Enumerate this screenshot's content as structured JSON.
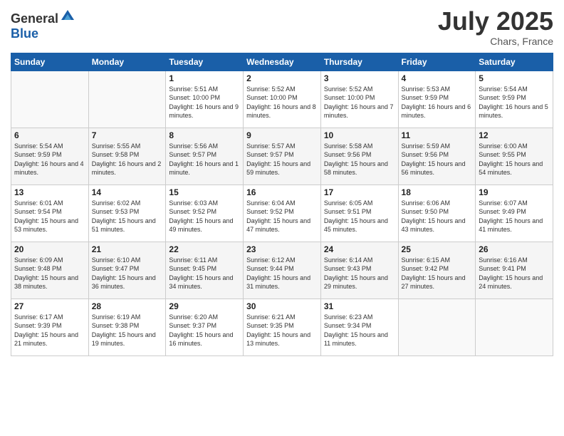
{
  "header": {
    "logo_general": "General",
    "logo_blue": "Blue",
    "month_year": "July 2025",
    "location": "Chars, France"
  },
  "days_of_week": [
    "Sunday",
    "Monday",
    "Tuesday",
    "Wednesday",
    "Thursday",
    "Friday",
    "Saturday"
  ],
  "weeks": [
    [
      {
        "day": "",
        "info": ""
      },
      {
        "day": "",
        "info": ""
      },
      {
        "day": "1",
        "info": "Sunrise: 5:51 AM\nSunset: 10:00 PM\nDaylight: 16 hours and 9 minutes."
      },
      {
        "day": "2",
        "info": "Sunrise: 5:52 AM\nSunset: 10:00 PM\nDaylight: 16 hours and 8 minutes."
      },
      {
        "day": "3",
        "info": "Sunrise: 5:52 AM\nSunset: 10:00 PM\nDaylight: 16 hours and 7 minutes."
      },
      {
        "day": "4",
        "info": "Sunrise: 5:53 AM\nSunset: 9:59 PM\nDaylight: 16 hours and 6 minutes."
      },
      {
        "day": "5",
        "info": "Sunrise: 5:54 AM\nSunset: 9:59 PM\nDaylight: 16 hours and 5 minutes."
      }
    ],
    [
      {
        "day": "6",
        "info": "Sunrise: 5:54 AM\nSunset: 9:59 PM\nDaylight: 16 hours and 4 minutes."
      },
      {
        "day": "7",
        "info": "Sunrise: 5:55 AM\nSunset: 9:58 PM\nDaylight: 16 hours and 2 minutes."
      },
      {
        "day": "8",
        "info": "Sunrise: 5:56 AM\nSunset: 9:57 PM\nDaylight: 16 hours and 1 minute."
      },
      {
        "day": "9",
        "info": "Sunrise: 5:57 AM\nSunset: 9:57 PM\nDaylight: 15 hours and 59 minutes."
      },
      {
        "day": "10",
        "info": "Sunrise: 5:58 AM\nSunset: 9:56 PM\nDaylight: 15 hours and 58 minutes."
      },
      {
        "day": "11",
        "info": "Sunrise: 5:59 AM\nSunset: 9:56 PM\nDaylight: 15 hours and 56 minutes."
      },
      {
        "day": "12",
        "info": "Sunrise: 6:00 AM\nSunset: 9:55 PM\nDaylight: 15 hours and 54 minutes."
      }
    ],
    [
      {
        "day": "13",
        "info": "Sunrise: 6:01 AM\nSunset: 9:54 PM\nDaylight: 15 hours and 53 minutes."
      },
      {
        "day": "14",
        "info": "Sunrise: 6:02 AM\nSunset: 9:53 PM\nDaylight: 15 hours and 51 minutes."
      },
      {
        "day": "15",
        "info": "Sunrise: 6:03 AM\nSunset: 9:52 PM\nDaylight: 15 hours and 49 minutes."
      },
      {
        "day": "16",
        "info": "Sunrise: 6:04 AM\nSunset: 9:52 PM\nDaylight: 15 hours and 47 minutes."
      },
      {
        "day": "17",
        "info": "Sunrise: 6:05 AM\nSunset: 9:51 PM\nDaylight: 15 hours and 45 minutes."
      },
      {
        "day": "18",
        "info": "Sunrise: 6:06 AM\nSunset: 9:50 PM\nDaylight: 15 hours and 43 minutes."
      },
      {
        "day": "19",
        "info": "Sunrise: 6:07 AM\nSunset: 9:49 PM\nDaylight: 15 hours and 41 minutes."
      }
    ],
    [
      {
        "day": "20",
        "info": "Sunrise: 6:09 AM\nSunset: 9:48 PM\nDaylight: 15 hours and 38 minutes."
      },
      {
        "day": "21",
        "info": "Sunrise: 6:10 AM\nSunset: 9:47 PM\nDaylight: 15 hours and 36 minutes."
      },
      {
        "day": "22",
        "info": "Sunrise: 6:11 AM\nSunset: 9:45 PM\nDaylight: 15 hours and 34 minutes."
      },
      {
        "day": "23",
        "info": "Sunrise: 6:12 AM\nSunset: 9:44 PM\nDaylight: 15 hours and 31 minutes."
      },
      {
        "day": "24",
        "info": "Sunrise: 6:14 AM\nSunset: 9:43 PM\nDaylight: 15 hours and 29 minutes."
      },
      {
        "day": "25",
        "info": "Sunrise: 6:15 AM\nSunset: 9:42 PM\nDaylight: 15 hours and 27 minutes."
      },
      {
        "day": "26",
        "info": "Sunrise: 6:16 AM\nSunset: 9:41 PM\nDaylight: 15 hours and 24 minutes."
      }
    ],
    [
      {
        "day": "27",
        "info": "Sunrise: 6:17 AM\nSunset: 9:39 PM\nDaylight: 15 hours and 21 minutes."
      },
      {
        "day": "28",
        "info": "Sunrise: 6:19 AM\nSunset: 9:38 PM\nDaylight: 15 hours and 19 minutes."
      },
      {
        "day": "29",
        "info": "Sunrise: 6:20 AM\nSunset: 9:37 PM\nDaylight: 15 hours and 16 minutes."
      },
      {
        "day": "30",
        "info": "Sunrise: 6:21 AM\nSunset: 9:35 PM\nDaylight: 15 hours and 13 minutes."
      },
      {
        "day": "31",
        "info": "Sunrise: 6:23 AM\nSunset: 9:34 PM\nDaylight: 15 hours and 11 minutes."
      },
      {
        "day": "",
        "info": ""
      },
      {
        "day": "",
        "info": ""
      }
    ]
  ]
}
